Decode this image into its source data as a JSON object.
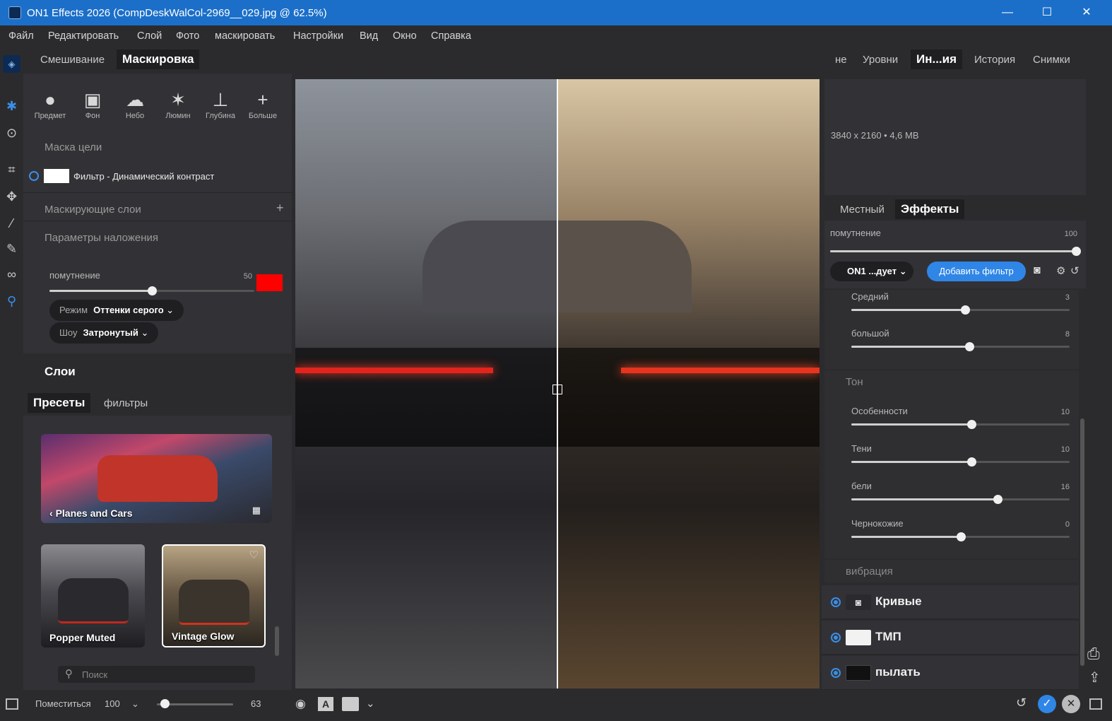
{
  "window": {
    "title": "ON1 Effects 2026 (CompDeskWalCol-2969__029.jpg @ 62.5%)",
    "minimize": "—",
    "maximize": "☐",
    "close": "✕"
  },
  "menu": [
    "Файл",
    "Редактировать",
    "Слой",
    "Фото",
    "маскировать",
    "Настройки",
    "Вид",
    "Окно",
    "Справка"
  ],
  "left": {
    "tabs": [
      "Смешивание",
      "Маскировка"
    ],
    "mask_tools": [
      {
        "label": "Предмет",
        "icon": "person-icon"
      },
      {
        "label": "Фон",
        "icon": "portrait-icon"
      },
      {
        "label": "Небо",
        "icon": "cloud-sun-icon"
      },
      {
        "label": "Люмин",
        "icon": "lighthouse-icon"
      },
      {
        "label": "Глубина",
        "icon": "depth-icon"
      },
      {
        "label": "Больше",
        "icon": "plus-icon"
      }
    ],
    "target_mask_title": "Маска цели",
    "target_mask_item": "Фильтр - Динамический контраст",
    "masking_layers": "Маскирующие слои",
    "masking_layers_add": "+",
    "overlay_params": "Параметры наложения",
    "overlay": {
      "label": "помутнение",
      "value": "50",
      "fraction": 0.5,
      "color": "#ff0000"
    },
    "mode": {
      "label": "Режим",
      "value": "Оттенки серого"
    },
    "show": {
      "label": "Шоу",
      "value": "Затронутый"
    },
    "layers_title": "Слои",
    "preset_tabs": [
      "Пресеты",
      "фильтры"
    ],
    "preset_category": "Planes and Cars",
    "presets": [
      "Popper Muted",
      "Vintage Glow"
    ],
    "search_placeholder": "Поиск"
  },
  "right": {
    "tabs": [
      "не",
      "Уровни",
      "Ин...ия",
      "История",
      "Снимки"
    ],
    "info": "3840 x 2160 • 4,6 MB",
    "effect_tabs": [
      "Местный",
      "Эффекты"
    ],
    "opacity": {
      "label": "помутнение",
      "value": "100",
      "fraction": 1.0
    },
    "preset_dropdown": "ON1 ...дует",
    "add_filter": "Добавить фильтр",
    "sliders_detail": [
      {
        "label": "Средний",
        "value": "3",
        "fraction": 0.52
      },
      {
        "label": "большой",
        "value": "8",
        "fraction": 0.54
      }
    ],
    "tone_title": "Тон",
    "sliders_tone": [
      {
        "label": "Особенности",
        "value": "10",
        "fraction": 0.55
      },
      {
        "label": "Тени",
        "value": "10",
        "fraction": 0.55
      },
      {
        "label": "бели",
        "value": "16",
        "fraction": 0.67
      },
      {
        "label": "Чернокожие",
        "value": "0",
        "fraction": 0.5
      }
    ],
    "vibration_title": "вибрация",
    "layers": [
      {
        "name": "Кривые"
      },
      {
        "name": "ТМП"
      },
      {
        "name": "пылать"
      }
    ]
  },
  "bottom": {
    "fit_label": "Поместиться",
    "zoom": "100",
    "value": "63",
    "zoom_fraction": 0.1
  },
  "colors": {
    "titlebar": "#1b6fc9",
    "accent": "#3a8ee6",
    "panel": "#2b2b2e"
  }
}
